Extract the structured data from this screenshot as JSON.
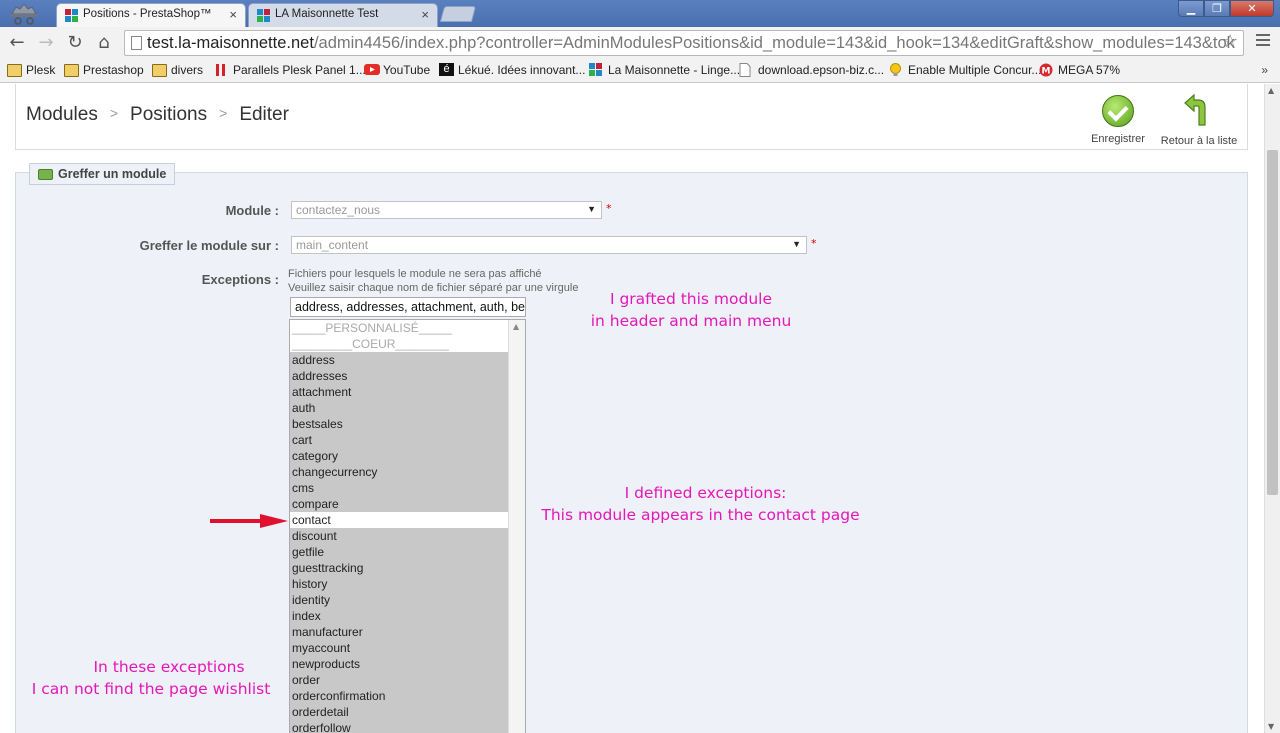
{
  "browser": {
    "tabs": [
      {
        "title": "Positions - PrestaShop™",
        "close": "×"
      },
      {
        "title": "LA Maisonnette Test",
        "close": "×"
      }
    ],
    "url_prefix": "test.la-maisonnette.net",
    "url_rest": "/admin4456/index.php?controller=AdminModulesPositions&id_module=143&id_hook=134&editGraft&show_modules=143&tok",
    "bookmarks": [
      "Plesk",
      "Prestashop",
      "divers",
      "Parallels Plesk Panel 1...",
      "YouTube",
      "Lékué. Idées innovant...",
      "La Maisonnette - Linge...",
      "download.epson-biz.c...",
      "Enable Multiple Concur...",
      "MEGA 57%"
    ],
    "bookmarks_more": "»"
  },
  "header": {
    "breadcrumb": [
      "Modules",
      "Positions",
      "Editer"
    ],
    "save_label": "Enregistrer",
    "back_label": "Retour à la liste"
  },
  "form": {
    "legend": "Greffer un module",
    "module_label": "Module :",
    "module_value": "contactez_nous",
    "hook_label": "Greffer le module sur :",
    "hook_value": "main_content",
    "required_mark": "*",
    "exceptions_label": "Exceptions :",
    "help_line1": "Fichiers pour lesquels le module ne sera pas affiché",
    "help_line2": "Veuillez saisir chaque nom de fichier séparé par une virgule",
    "exceptions_value": "address, addresses, attachment, auth, be",
    "list_items": [
      "_____PERSONNALISÉ_____",
      "_________COEUR________",
      "address",
      "addresses",
      "attachment",
      "auth",
      "bestsales",
      "cart",
      "category",
      "changecurrency",
      "cms",
      "compare",
      "contact",
      "discount",
      "getfile",
      "guesttracking",
      "history",
      "identity",
      "index",
      "manufacturer",
      "myaccount",
      "newproducts",
      "order",
      "orderconfirmation",
      "orderdetail",
      "orderfollow"
    ],
    "unselected_item": "contact"
  },
  "annotations": {
    "note1_line1": "I grafted this module",
    "note1_line2": "in header and main menu",
    "note2_line1": "I defined exceptions:",
    "note2_line2": "This module appears in the contact page",
    "note3_line1": "In these exceptions",
    "note3_line2": "I can not find the page wishlist",
    "color": "#e617b8",
    "arrow_color": "#e0102f"
  },
  "colors": {
    "panel_bg": "#eef1f7",
    "list_selected_bg": "#c8c8c8",
    "chrome_frame": "#5a80c0"
  }
}
